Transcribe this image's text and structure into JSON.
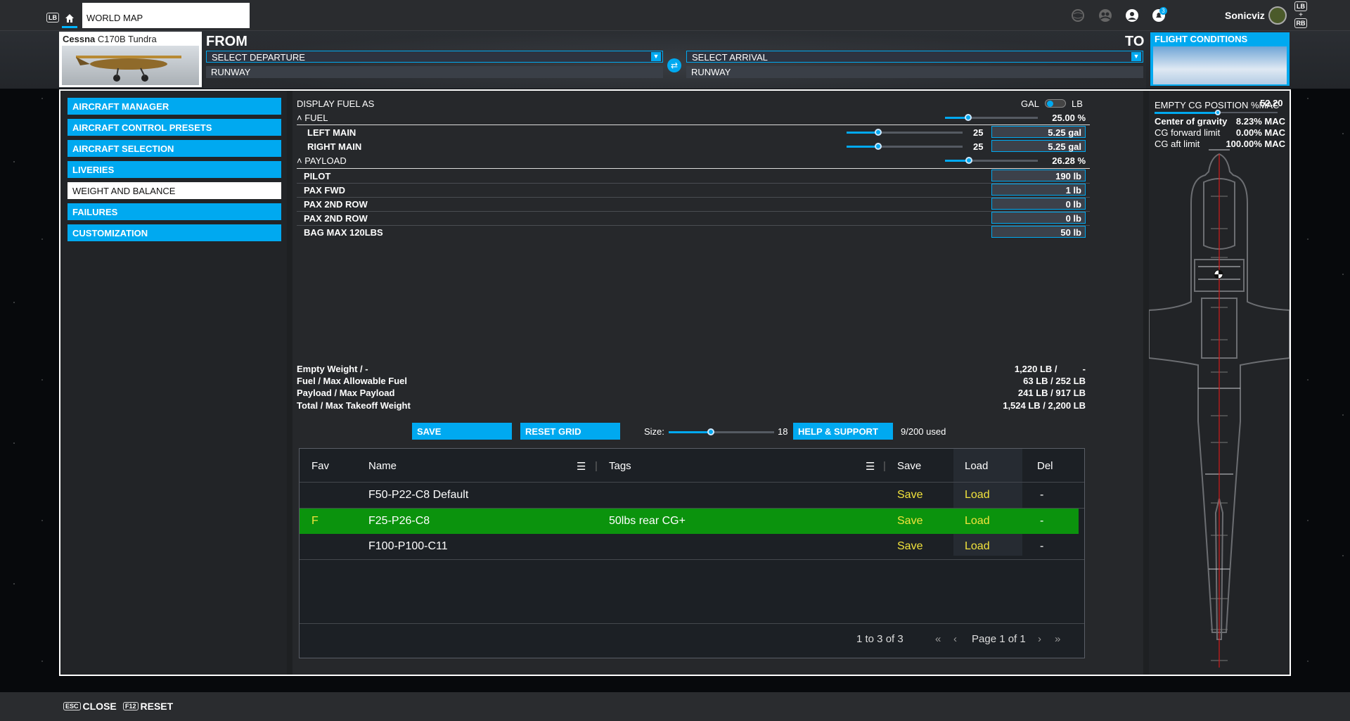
{
  "topbar": {
    "lb": "LB",
    "tab_title": "WORLD MAP",
    "notif_count": "3",
    "user_name": "Sonicviz",
    "rb_top": "LB",
    "rb_plus": "+",
    "rb_bottom": "RB"
  },
  "flight": {
    "aircraft_brand": "Cessna",
    "aircraft_model": " C170B Tundra",
    "from_label": "FROM",
    "to_label": "TO",
    "departure_placeholder": "SELECT DEPARTURE",
    "arrival_placeholder": "SELECT ARRIVAL",
    "runway_from": "RUNWAY",
    "runway_to": "RUNWAY",
    "conditions_label": "FLIGHT CONDITIONS"
  },
  "menu": {
    "items": [
      {
        "label": "AIRCRAFT MANAGER"
      },
      {
        "label": "AIRCRAFT CONTROL PRESETS"
      },
      {
        "label": "AIRCRAFT SELECTION"
      },
      {
        "label": "LIVERIES"
      },
      {
        "label": "WEIGHT AND BALANCE"
      },
      {
        "label": "FAILURES"
      },
      {
        "label": "CUSTOMIZATION"
      }
    ],
    "active_index": 4
  },
  "weights": {
    "display_fuel_label": "DISPLAY FUEL AS",
    "unit_left": "GAL",
    "unit_right": "LB",
    "fuel_label": "FUEL",
    "fuel_pct": "25.00 %",
    "fuel_level": 0.25,
    "left_main_label": "LEFT MAIN",
    "left_main_num": "25",
    "left_main_val": "5.25 gal",
    "right_main_label": "RIGHT MAIN",
    "right_main_num": "25",
    "right_main_val": "5.25 gal",
    "payload_label": "PAYLOAD",
    "payload_pct": "26.28 %",
    "payload_level": 0.2628,
    "stations": [
      {
        "label": "PILOT",
        "value": "190 lb"
      },
      {
        "label": "PAX FWD",
        "value": "1 lb"
      },
      {
        "label": "PAX 2ND ROW",
        "value": "0 lb"
      },
      {
        "label": "PAX 2ND ROW",
        "value": "0 lb"
      },
      {
        "label": "BAG MAX 120LBS",
        "value": "50 lb"
      }
    ]
  },
  "summary": [
    {
      "label": "Empty Weight / -",
      "value": "1,220 LB /          -"
    },
    {
      "label": "Fuel / Max Allowable Fuel",
      "value": "63 LB / 252 LB"
    },
    {
      "label": "Payload / Max Payload",
      "value": "241 LB / 917 LB"
    },
    {
      "label": "Total / Max Takeoff Weight",
      "value": "1,524 LB / 2,200 LB"
    }
  ],
  "actions": {
    "save": "SAVE",
    "reset_grid": "RESET GRID",
    "size_label": "Size:",
    "size_value": "18",
    "help": "HELP & SUPPORT",
    "used": "9/200 used"
  },
  "grid": {
    "headers": {
      "fav": "Fav",
      "name": "Name",
      "tags": "Tags",
      "save": "Save",
      "load": "Load",
      "del": "Del"
    },
    "rows": [
      {
        "fav": "",
        "name": "F50-P22-C8 Default",
        "tags": "",
        "save": "Save",
        "load": "Load",
        "del": "-"
      },
      {
        "fav": "F",
        "name": "F25-P26-C8",
        "tags": "50lbs rear CG+",
        "save": "Save",
        "load": "Load",
        "del": "-"
      },
      {
        "fav": "",
        "name": "F100-P100-C11",
        "tags": "",
        "save": "Save",
        "load": "Load",
        "del": "-"
      }
    ],
    "range_text": "1 to 3 of 3",
    "page_text": "Page 1 of 1"
  },
  "cg": {
    "title": "EMPTY CG POSITION %MAC",
    "value": "52.20",
    "cg_label": "Center of gravity",
    "cg_value": "8.23% MAC",
    "fwd_label": "CG forward limit",
    "fwd_value": "0.00% MAC",
    "aft_label": "CG aft limit",
    "aft_value": "100.00% MAC"
  },
  "footer": {
    "close_key": "ESC",
    "close_label": "CLOSE",
    "reset_key": "F12",
    "reset_label": "RESET"
  },
  "colors": {
    "accent": "#00a9f0",
    "highlight_row": "#0b930d",
    "yellow_text": "#f2e33c"
  }
}
